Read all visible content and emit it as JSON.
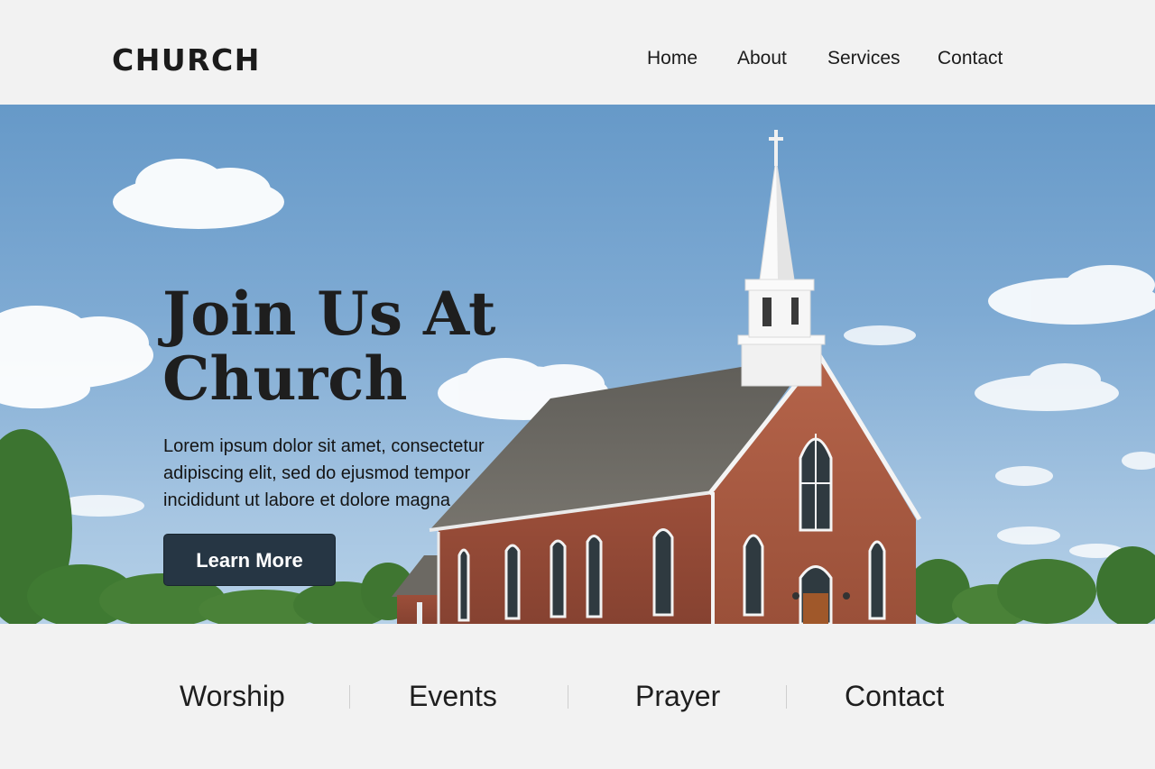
{
  "header": {
    "logo": "CHURCH",
    "nav": [
      {
        "label": "Home"
      },
      {
        "label": "About"
      },
      {
        "label": "Services"
      },
      {
        "label": "Contact"
      }
    ]
  },
  "hero": {
    "title_line1": "Join Us At",
    "title_line2": "Church",
    "body_lines": [
      "Lorem ipsum dolor sit amet, consectetur",
      "adipiscing elit, sed do ejusmod tempor",
      "incididunt ut labore et dolore magna"
    ],
    "button_label": "Learn More"
  },
  "features": [
    {
      "label": "Worship"
    },
    {
      "label": "Events"
    },
    {
      "label": "Prayer"
    },
    {
      "label": "Contact"
    }
  ],
  "colors": {
    "background": "#f2f2f2",
    "sky": "#7eaad3",
    "brick": "#a65a42",
    "button": "#263644",
    "text": "#1e1e1e"
  }
}
